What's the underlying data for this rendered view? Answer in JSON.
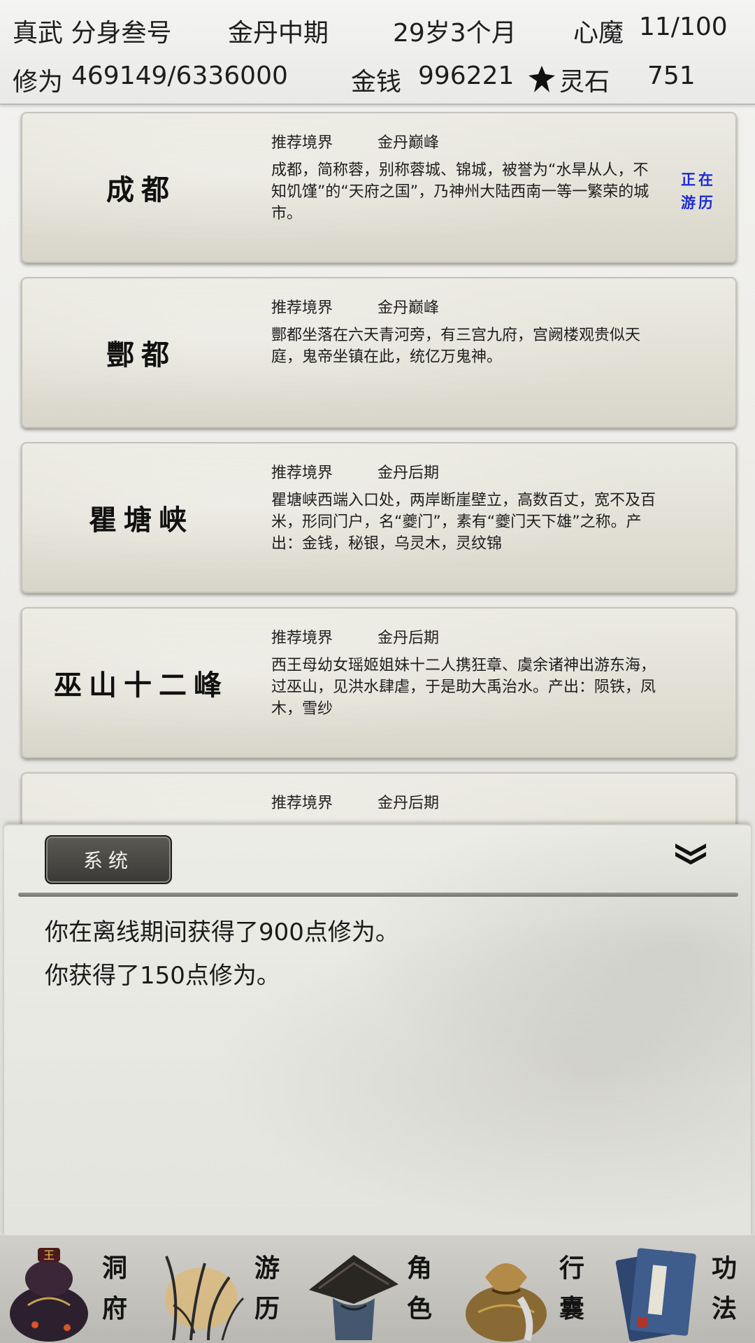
{
  "status": {
    "name": "真武 分身叁号",
    "realm": "金丹中期",
    "age": "29岁3个月",
    "inner_demon_label": "心魔",
    "inner_demon_value": "11/100",
    "cultivation_label": "修为",
    "cultivation_value": "469149/6336000",
    "money_label": "金钱",
    "money_value": "996221",
    "spirit_stone_label": "灵石",
    "spirit_stone_value": "751",
    "spirit_stone_icon": "spirit-stone-icon"
  },
  "areas": [
    {
      "name": "成都",
      "realm_label": "推荐境界",
      "realm": "金丹巅峰",
      "desc": "成都，简称蓉，别称蓉城、锦城，被誉为“水旱从人，不知饥馑”的“天府之国”，乃神州大陆西南一等一繁荣的城市。",
      "status_line1": "正在",
      "status_line2": "游历"
    },
    {
      "name": "酆都",
      "realm_label": "推荐境界",
      "realm": "金丹巅峰",
      "desc": "酆都坐落在六天青河旁，有三宫九府，宫阙楼观贵似天庭，鬼帝坐镇在此，统亿万鬼神。"
    },
    {
      "name": "瞿塘峡",
      "realm_label": "推荐境界",
      "realm": "金丹后期",
      "desc": "瞿塘峡西端入口处，两岸断崖壁立，高数百丈，宽不及百米，形同门户，名“夔门”，素有“夔门天下雄”之称。产出：金钱，秘银，乌灵木，灵纹锦"
    },
    {
      "name": "巫山十二峰",
      "realm_label": "推荐境界",
      "realm": "金丹后期",
      "desc": "西王母幼女瑶姬姐妹十二人携狂章、虞余诸神出游东海，过巫山，见洪水肆虐，于是助大禹治水。产出：陨铁，凤木，雪纱"
    },
    {
      "name": "",
      "realm_label": "推荐境界",
      "realm": "金丹后期",
      "desc": ""
    }
  ],
  "messages": {
    "tab_label": "系统",
    "lines": [
      "你在离线期间获得了900点修为。",
      "你获得了150点修为。"
    ]
  },
  "nav": [
    {
      "label1": "洞",
      "label2": "府",
      "icon": "cave-gourd-icon"
    },
    {
      "label1": "游",
      "label2": "历",
      "icon": "travel-grass-icon"
    },
    {
      "label1": "角",
      "label2": "色",
      "icon": "character-hat-icon"
    },
    {
      "label1": "行",
      "label2": "囊",
      "icon": "bag-icon"
    },
    {
      "label1": "功",
      "label2": "法",
      "icon": "technique-book-icon"
    }
  ],
  "colors": {
    "status_accent": "#1b2bd6",
    "tab_bg": "#4a4844"
  }
}
